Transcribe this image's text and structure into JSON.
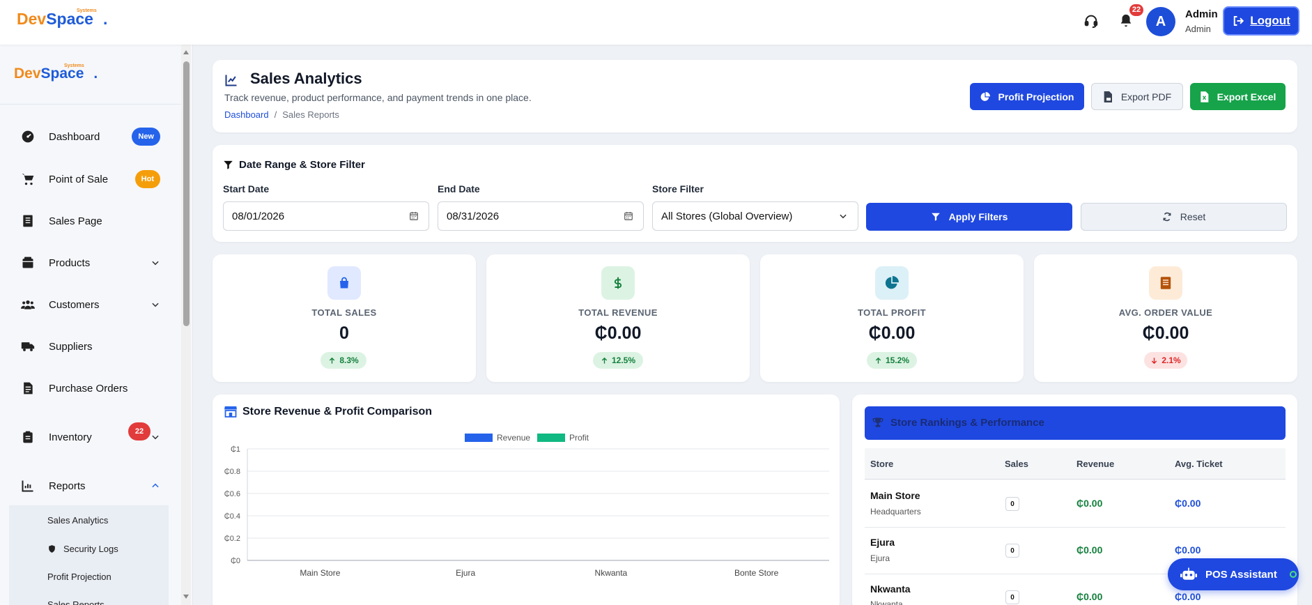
{
  "brand": {
    "dev": "Dev",
    "space": "Space",
    "systems": "Systems",
    "dot": "."
  },
  "header": {
    "notif_count": "22",
    "avatar_letter": "A",
    "user_name": "Admin",
    "user_role": "Admin",
    "logout_label": "Logout"
  },
  "sidebar": {
    "items": [
      {
        "label": "Dashboard",
        "icon": "dashboard-icon",
        "badge": "New",
        "badge_color": "#2563eb"
      },
      {
        "label": "Point of Sale",
        "icon": "cart-icon",
        "badge": "Hot",
        "badge_color": "#f59e0b"
      },
      {
        "label": "Sales Page",
        "icon": "receipt-icon"
      },
      {
        "label": "Products",
        "icon": "box-icon",
        "expandable": true
      },
      {
        "label": "Customers",
        "icon": "users-icon",
        "expandable": true
      },
      {
        "label": "Suppliers",
        "icon": "truck-icon"
      },
      {
        "label": "Purchase Orders",
        "icon": "file-invoice-icon"
      },
      {
        "label": "Inventory",
        "icon": "clipboard-icon",
        "badge": "22",
        "badge_color": "#e23b3b",
        "expandable": true
      },
      {
        "label": "Reports",
        "icon": "chart-icon",
        "expanded": true
      }
    ],
    "sub_items": [
      "Sales Analytics",
      "Security Logs",
      "Profit Projection",
      "Sales Reports"
    ]
  },
  "page": {
    "title": "Sales Analytics",
    "subtitle": "Track revenue, product performance, and payment trends in one place.",
    "breadcrumb_home": "Dashboard",
    "breadcrumb_sep": "/",
    "breadcrumb_current": "Sales Reports",
    "btn_projection": "Profit Projection",
    "btn_pdf": "Export PDF",
    "btn_excel": "Export Excel"
  },
  "filter": {
    "title": "Date Range & Store Filter",
    "start_label": "Start Date",
    "start_value": "08/01/2026",
    "end_label": "End Date",
    "end_value": "08/31/2026",
    "store_label": "Store Filter",
    "store_value": "All Stores (Global Overview)",
    "apply_label": "Apply Filters",
    "reset_label": "Reset"
  },
  "stats": [
    {
      "title": "TOTAL SALES",
      "value": "0",
      "trend": "8.3%",
      "direction": "up",
      "icon": "bag-icon",
      "color": "#2563eb",
      "bg": "#e0e9ff"
    },
    {
      "title": "TOTAL REVENUE",
      "value": "₵0.00",
      "trend": "12.5%",
      "direction": "up",
      "icon": "dollar-icon",
      "color": "#15803d",
      "bg": "#dcf3e3"
    },
    {
      "title": "TOTAL PROFIT",
      "value": "₵0.00",
      "trend": "15.2%",
      "direction": "up",
      "icon": "pie-icon",
      "color": "#0e7490",
      "bg": "#dcf0f7"
    },
    {
      "title": "AVG. ORDER VALUE",
      "value": "₵0.00",
      "trend": "2.1%",
      "direction": "down",
      "icon": "receipt-icon",
      "color": "#b45309",
      "bg": "#fdebd8"
    }
  ],
  "chart_panel_title": "Store Revenue & Profit Comparison",
  "chart_data": {
    "type": "bar",
    "title": "",
    "categories": [
      "Main Store",
      "Ejura",
      "Nkwanta",
      "Bonte Store"
    ],
    "series": [
      {
        "name": "Revenue",
        "values": [
          0,
          0,
          0,
          0
        ],
        "color": "#2563eb"
      },
      {
        "name": "Profit",
        "values": [
          0,
          0,
          0,
          0
        ],
        "color": "#10b981"
      }
    ],
    "yticks": [
      "₵0",
      "₵0.2",
      "₵0.4",
      "₵0.6",
      "₵0.8",
      "₵1"
    ],
    "ylim": [
      0,
      1
    ],
    "xlabel": "",
    "ylabel": "",
    "grid": true,
    "legend": "top-center"
  },
  "rankings": {
    "title": "Store Rankings & Performance",
    "columns": [
      "Store",
      "Sales",
      "Revenue",
      "Avg. Ticket"
    ],
    "rows": [
      {
        "name": "Main Store",
        "sub": "Headquarters",
        "sales": "0",
        "revenue": "₵0.00",
        "ticket": "₵0.00"
      },
      {
        "name": "Ejura",
        "sub": "Ejura",
        "sales": "0",
        "revenue": "₵0.00",
        "ticket": "₵0.00"
      },
      {
        "name": "Nkwanta",
        "sub": "Nkwanta",
        "sales": "0",
        "revenue": "₵0.00",
        "ticket": "₵0.00"
      }
    ]
  },
  "assistant": {
    "label": "POS Assistant"
  }
}
